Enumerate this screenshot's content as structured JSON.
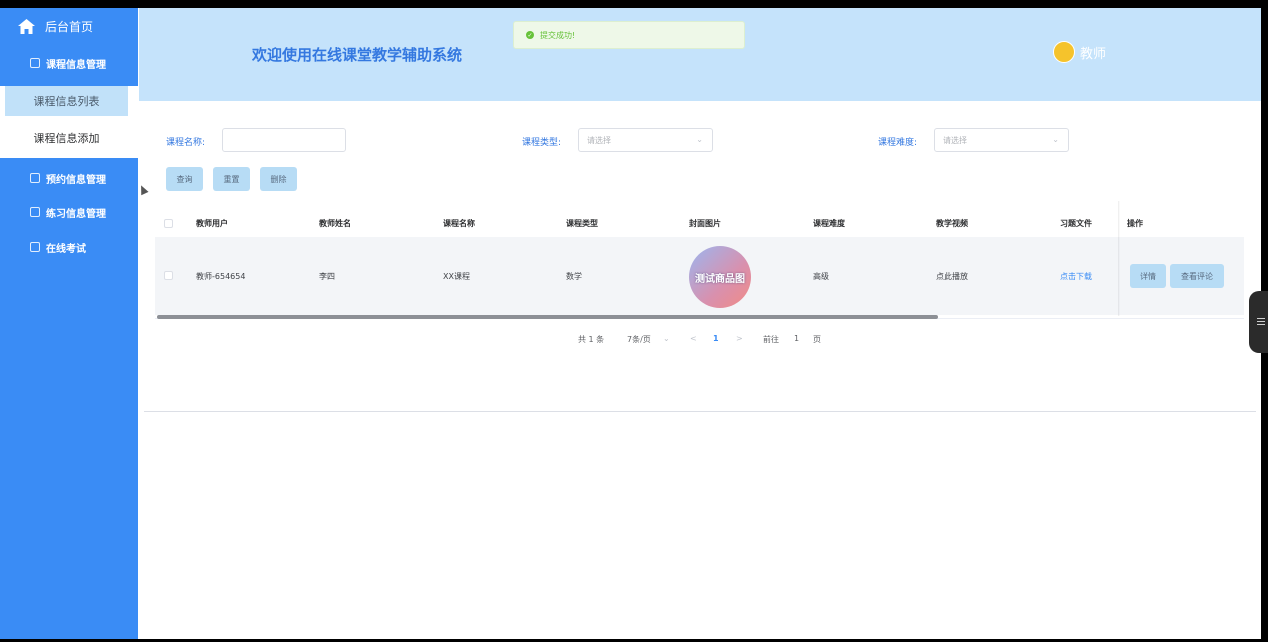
{
  "sidebar": {
    "home": "后台首页",
    "groups": [
      {
        "label": "课程信息管理"
      },
      {
        "label": "预约信息管理"
      },
      {
        "label": "练习信息管理"
      },
      {
        "label": "在线考试"
      }
    ],
    "sub_items": [
      "课程信息列表",
      "课程信息添加"
    ]
  },
  "header": {
    "title": "欢迎使用在线课堂教学辅助系统",
    "toast": "提交成功!",
    "user": "教师"
  },
  "search": {
    "course_name_label": "课程名称:",
    "course_name_value": "",
    "course_type_label": "课程类型:",
    "course_type_placeholder": "请选择",
    "difficulty_label": "课程难度:",
    "difficulty_placeholder": "请选择",
    "buttons": [
      "查询",
      "重置",
      "删除"
    ]
  },
  "table": {
    "columns": [
      "教师用户",
      "教师姓名",
      "课程名称",
      "课程类型",
      "封面图片",
      "课程难度",
      "教学视频",
      "习题文件",
      "操作"
    ],
    "rows": [
      {
        "teacher_user": "教师-654654",
        "teacher_name": "李四",
        "course_name": "XX课程",
        "course_type": "数学",
        "cover_text": "测试商品图",
        "difficulty": "高级",
        "video": "点此播放",
        "exercise": "点击下载",
        "actions": [
          "详情",
          "查看评论"
        ]
      }
    ]
  },
  "pagination": {
    "total": "共 1 条",
    "page_size": "7条/页",
    "prev": "<",
    "current": "1",
    "next": ">",
    "goto_label": "前往",
    "goto_value": "1",
    "page_suffix": "页"
  },
  "colors": {
    "sidebar": "#3a8cf5",
    "header": "#c5e3fb",
    "accent": "#3478e0",
    "button": "#b7dcf5",
    "success": "#67c23a"
  }
}
